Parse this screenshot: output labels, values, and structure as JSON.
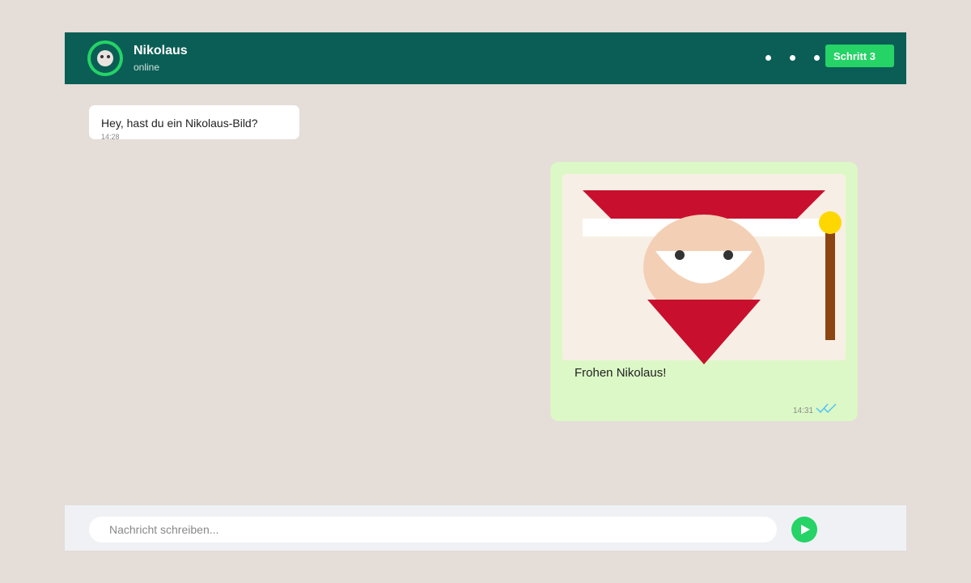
{
  "header": {
    "contact_name": "Nikolaus",
    "status": "online",
    "step_button": "Schritt 3",
    "menu_icon": "more-dots-icon",
    "avatar_icon": "avatar-face-icon"
  },
  "messages": [
    {
      "direction": "incoming",
      "text": "Hey, hast du ein Nikolaus-Bild?",
      "time": "14:28"
    },
    {
      "direction": "outgoing",
      "image": "santa-illustration",
      "caption": "Frohen Nikolaus!",
      "time": "14:31",
      "status_icon": "double-check-icon"
    }
  ],
  "composer": {
    "placeholder": "Nachricht schreiben...",
    "send_icon": "send-icon"
  },
  "colors": {
    "background": "#e4ddd8",
    "header": "#0a5e55",
    "accent": "#25d366",
    "outgoing_bubble": "#dcf8c6",
    "incoming_bubble": "#ffffff",
    "hat_red": "#c8102e",
    "skin": "#f3d0b5",
    "staff_brown": "#8b4513",
    "staff_gold": "#ffd700",
    "read_tick": "#4fc3f7"
  }
}
